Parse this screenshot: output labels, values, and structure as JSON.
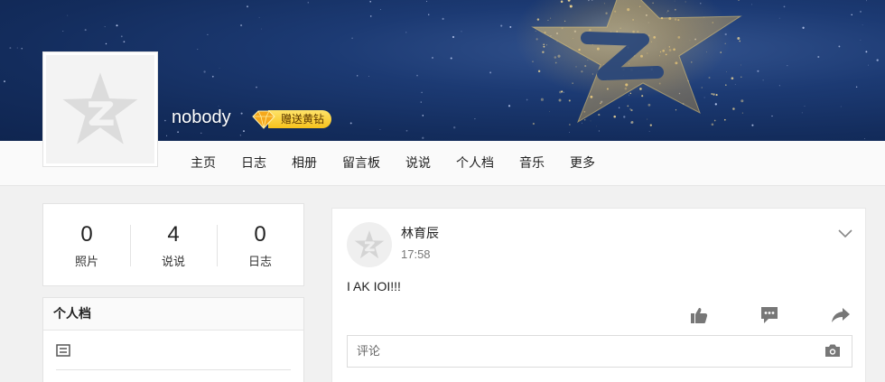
{
  "header": {
    "username": "nobody",
    "vip_label": "赠送黄钻"
  },
  "nav": [
    {
      "label": "主页"
    },
    {
      "label": "日志"
    },
    {
      "label": "相册"
    },
    {
      "label": "留言板"
    },
    {
      "label": "说说"
    },
    {
      "label": "个人档"
    },
    {
      "label": "音乐"
    },
    {
      "label": "更多"
    }
  ],
  "stats": [
    {
      "value": "0",
      "label": "照片"
    },
    {
      "value": "4",
      "label": "说说"
    },
    {
      "value": "0",
      "label": "日志"
    }
  ],
  "profile": {
    "title": "个人档"
  },
  "post": {
    "author": "林育辰",
    "time": "17:58",
    "content": "I AK IOI!!!",
    "comment_placeholder": "评论"
  },
  "icons": {
    "like": "thumbs-up-icon",
    "comment": "comment-icon",
    "share": "share-icon",
    "camera": "camera-icon",
    "menu": "chevron-down-icon",
    "profile_row": "document-icon"
  },
  "colors": {
    "banner": "#1c3a73",
    "vip_gold": "#f6c21c",
    "icon_gray": "#777777"
  }
}
